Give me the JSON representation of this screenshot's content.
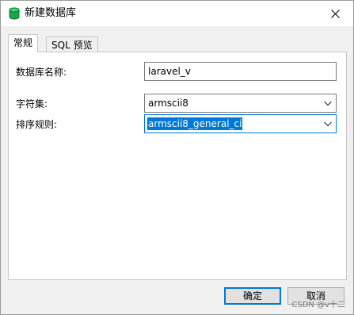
{
  "window": {
    "title": "新建数据库",
    "close_glyph": "✕"
  },
  "tabs": [
    {
      "label": "常规",
      "active": true
    },
    {
      "label": "SQL 预览",
      "active": false
    }
  ],
  "form": {
    "db_name_label": "数据库名称:",
    "db_name_value": "laravel_v",
    "charset_label": "字符集:",
    "charset_value": "armscii8",
    "collation_label": "排序规则:",
    "collation_value": "armscii8_general_ci"
  },
  "buttons": {
    "ok": "确定",
    "cancel": "取消"
  },
  "watermark": "CSDN @v十二",
  "icons": {
    "title": "database-icon",
    "close": "close-icon",
    "dropdown": "chevron-down-icon"
  },
  "colors": {
    "accent": "#0078d7",
    "db_icon": "#1aa34a"
  }
}
